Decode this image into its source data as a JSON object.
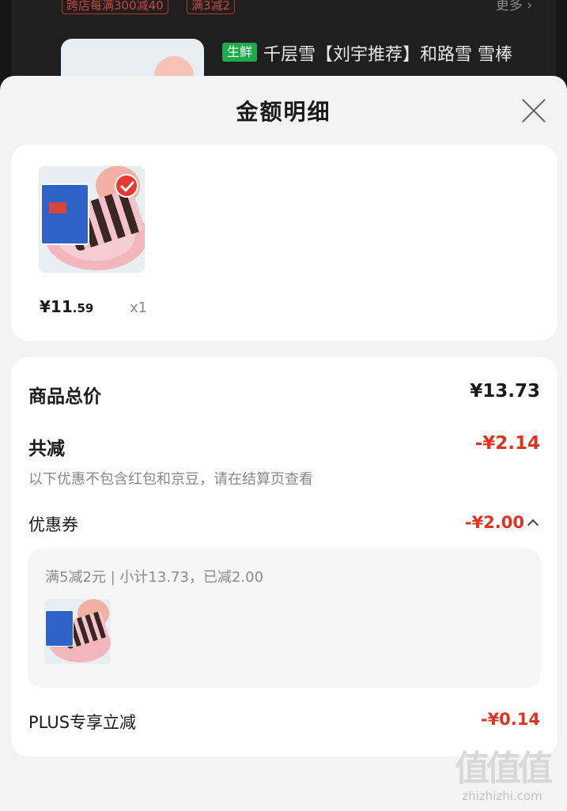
{
  "background": {
    "promo_tags": [
      "跨店每满300减40",
      "满3减2"
    ],
    "more_label": "更多",
    "fresh_badge": "生鲜",
    "product_title": "千层雪【刘宇推荐】和路雪 雪棒"
  },
  "sheet": {
    "title": "金额明细",
    "item": {
      "price_yen": "¥11",
      "price_cents": ".59",
      "quantity": "x1"
    },
    "summary": {
      "total_label": "商品总价",
      "total_value": "¥13.73",
      "discount_label": "共减",
      "discount_value": "-¥2.14",
      "note": "以下优惠不包含红包和京豆，请在结算页查看",
      "coupon_label": "优惠券",
      "coupon_value": "-¥2.00",
      "coupon_detail": "满5减2元 | 小计13.73，已减2.00",
      "plus_label": "PLUS专享立减",
      "plus_value": "-¥0.14"
    }
  },
  "watermark": {
    "logo": "值值值",
    "site": "zhizhizhi.com"
  },
  "colors": {
    "accent_red": "#e23322",
    "fresh_green": "#1faa4c"
  }
}
